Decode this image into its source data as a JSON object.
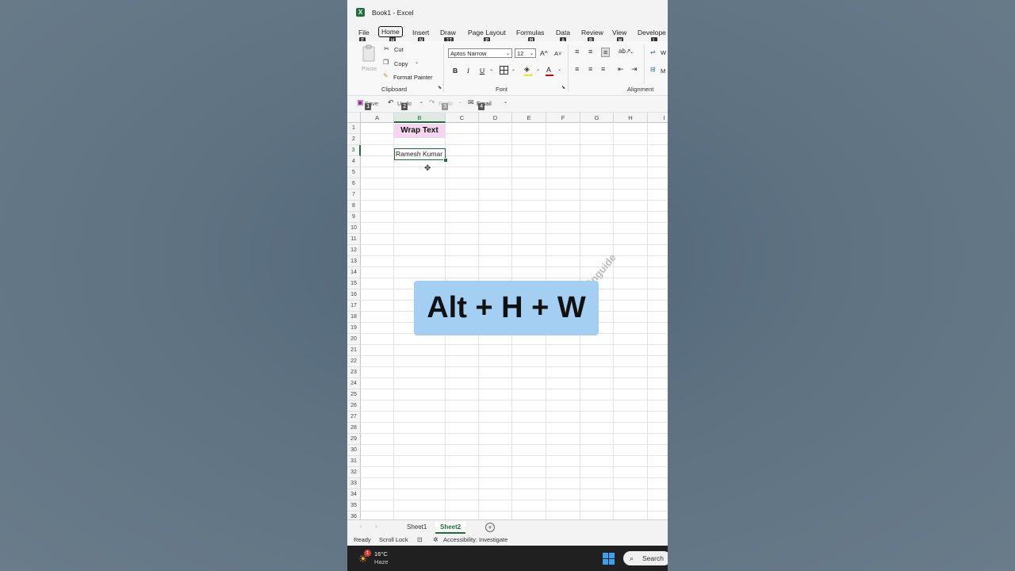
{
  "window": {
    "title": "Book1  -  Excel"
  },
  "menu": {
    "tabs": [
      {
        "label": "File",
        "keytip": "F"
      },
      {
        "label": "Home",
        "keytip": "H"
      },
      {
        "label": "Insert",
        "keytip": "N"
      },
      {
        "label": "Draw",
        "keytip": "JI"
      },
      {
        "label": "Page Layout",
        "keytip": "P"
      },
      {
        "label": "Formulas",
        "keytip": "M"
      },
      {
        "label": "Data",
        "keytip": "A"
      },
      {
        "label": "Review",
        "keytip": "R"
      },
      {
        "label": "View",
        "keytip": "W"
      },
      {
        "label": "Develope",
        "keytip": "L"
      }
    ]
  },
  "ribbon": {
    "clipboard": {
      "paste": "Paste",
      "cut": "Cut",
      "copy": "Copy",
      "format_painter": "Format Painter",
      "label": "Clipboard"
    },
    "font": {
      "name": "Aptos Narrow",
      "size": "12",
      "grow": "A^",
      "shrink": "A˅",
      "bold": "B",
      "italic": "I",
      "underline": "U",
      "color_letter": "A",
      "label": "Font"
    },
    "alignment": {
      "label": "Alignment",
      "wrap": "W",
      "merge": "M"
    }
  },
  "qat": {
    "save": "Save",
    "undo": "Undo",
    "redo": "Redo",
    "email": "Email",
    "keytips": [
      "1",
      "2",
      "3",
      "4"
    ]
  },
  "grid": {
    "columns": [
      "A",
      "B",
      "C",
      "D",
      "E",
      "F",
      "G",
      "H",
      "I"
    ],
    "rows": [
      "1",
      "2",
      "3",
      "4",
      "5",
      "6",
      "7",
      "8",
      "9",
      "10",
      "11",
      "12",
      "13",
      "14",
      "15",
      "16",
      "17",
      "18",
      "19",
      "20",
      "21",
      "22",
      "23",
      "24",
      "25",
      "26",
      "27",
      "28",
      "29",
      "30",
      "31",
      "32",
      "33",
      "34",
      "35",
      "36"
    ],
    "b1": "Wrap Text",
    "b3": "Ramesh Kumar"
  },
  "watermark": "Focusinguide",
  "overlay": "Alt + H + W",
  "sheets": {
    "tabs": [
      "Sheet1",
      "Sheet2"
    ],
    "active": "Sheet2"
  },
  "status": {
    "ready": "Ready",
    "scroll_lock": "Scroll Lock",
    "accessibility": "Accessibility: Investigate"
  },
  "taskbar": {
    "temp": "16°C",
    "weather": "Haze",
    "badge": "1",
    "search": "Search"
  },
  "colors": {
    "accent": "#1e6e3a",
    "overlay": "#a4cff2",
    "header_fill": "#f4d4ee"
  }
}
